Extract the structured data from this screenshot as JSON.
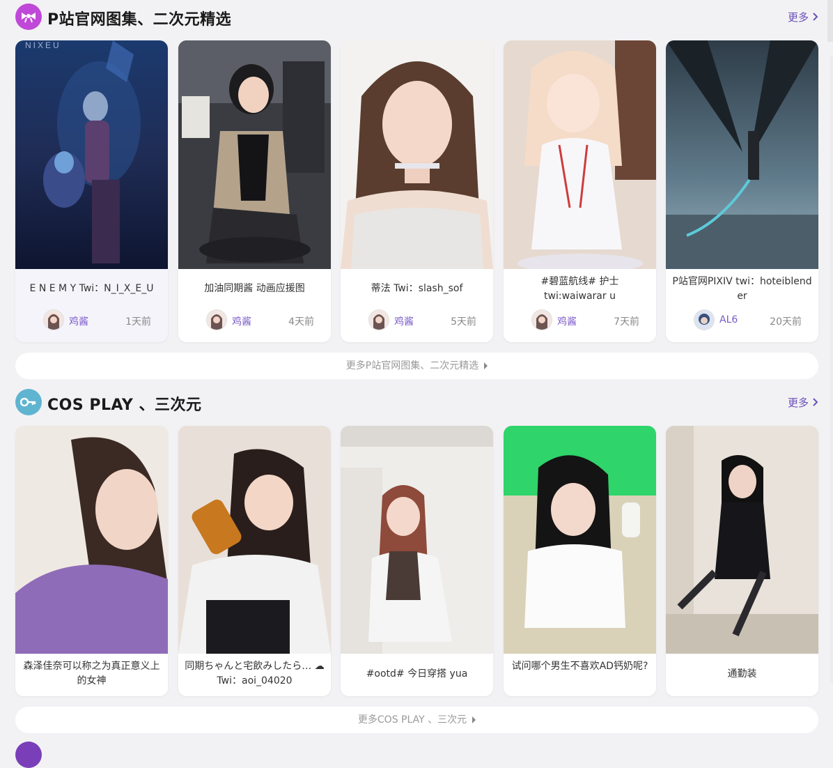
{
  "sections": [
    {
      "title": "P站官网图集、二次元精选",
      "more_label": "更多",
      "icon": "bow-icon",
      "icon_color": "#c048d8",
      "more_bar": "更多P站官网图集、二次元精选",
      "cards": [
        {
          "title": "E N E M Y Twi：N_I_X_E_U",
          "user": "鸡酱",
          "time": "1天前",
          "thumb_label": "NIXEU"
        },
        {
          "title": "加油同期酱 动画应援图",
          "user": "鸡酱",
          "time": "4天前"
        },
        {
          "title": "蒂法 Twi：slash_sof",
          "user": "鸡酱",
          "time": "5天前"
        },
        {
          "title": "#碧蓝航线# 护士 twi:waiwarar u",
          "user": "鸡酱",
          "time": "7天前"
        },
        {
          "title": "P站官网PIXIV twi：hoteiblend er",
          "user": "AL6",
          "time": "20天前"
        }
      ]
    },
    {
      "title": "COS PLAY 、三次元",
      "more_label": "更多",
      "icon": "key-icon",
      "icon_color": "#5fb4d0",
      "more_bar": "更多COS PLAY 、三次元",
      "cards": [
        {
          "title": "森泽佳奈可以称之为真正意义上的女神"
        },
        {
          "title": "同期ちゃんと宅飲みしたら… ☁ Twi：aoi_04020"
        },
        {
          "title": "#ootd# 今日穿搭 yua"
        },
        {
          "title": "试问哪个男生不喜欢AD钙奶呢?"
        },
        {
          "title": "通勤装"
        }
      ]
    }
  ],
  "colors": {
    "accent": "#6b4fb8",
    "user": "#7a5ac8",
    "background": "#f2f2f4"
  }
}
